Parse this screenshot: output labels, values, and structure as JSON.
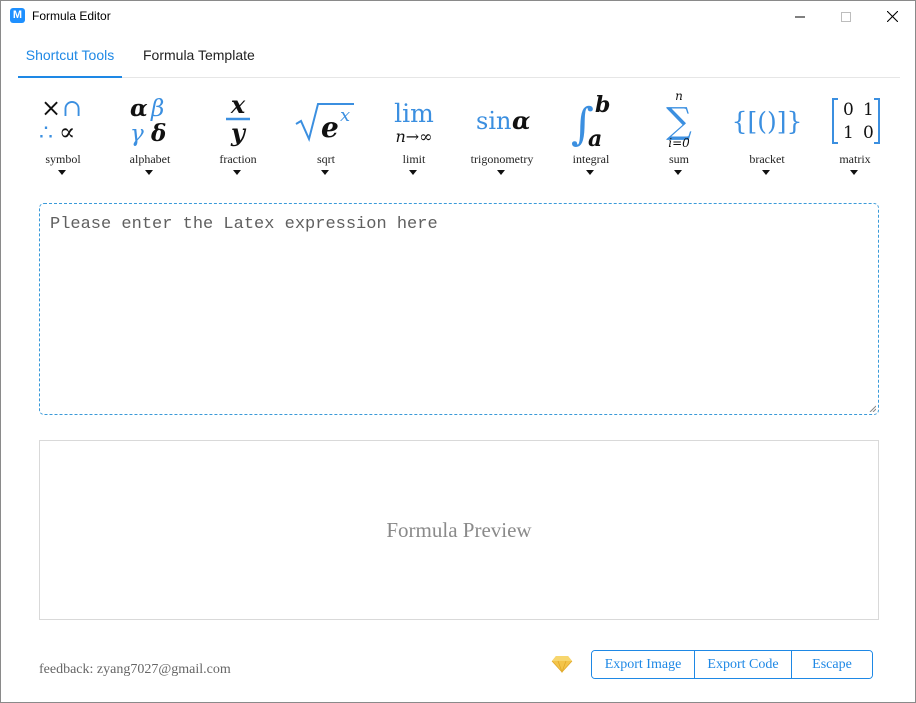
{
  "window": {
    "title": "Formula Editor",
    "icon": "M",
    "controls": [
      "minimize-icon",
      "maximize-icon",
      "close-icon"
    ]
  },
  "tabs": [
    {
      "label": "Shortcut Tools",
      "active": true
    },
    {
      "label": "Formula Template",
      "active": false
    }
  ],
  "tools": [
    {
      "label": "symbol",
      "icon": "symbol-icon"
    },
    {
      "label": "alphabet",
      "icon": "alphabet-icon"
    },
    {
      "label": "fraction",
      "icon": "fraction-icon"
    },
    {
      "label": "sqrt",
      "icon": "sqrt-icon"
    },
    {
      "label": "limit",
      "icon": "limit-icon"
    },
    {
      "label": "trigonometry",
      "icon": "trigonometry-icon"
    },
    {
      "label": "integral",
      "icon": "integral-icon"
    },
    {
      "label": "sum",
      "icon": "sum-icon"
    },
    {
      "label": "bracket",
      "icon": "bracket-icon"
    },
    {
      "label": "matrix",
      "icon": "matrix-icon"
    }
  ],
  "glyphs": {
    "symbol": {
      "times": "×",
      "cap": "∩",
      "therefore": "∴",
      "propto": "∝"
    },
    "alphabet": {
      "alpha": "α",
      "beta": "β",
      "gamma": "γ",
      "delta": "δ"
    },
    "fraction": {
      "num": "x",
      "den": "y"
    },
    "sqrt": {
      "radicand": "e",
      "exp": "x"
    },
    "limit": {
      "op": "lim",
      "sub": "n→∞"
    },
    "trigonometry": {
      "fn": "sin",
      "arg": "α"
    },
    "integral": {
      "sign": "∫",
      "upper": "b",
      "lower": "a"
    },
    "sum": {
      "sign": "∑",
      "upper": "n",
      "lower": "i=0"
    },
    "bracket": {
      "text": "{[()]}"
    },
    "matrix": {
      "cells": [
        "0",
        "1",
        "1",
        "0"
      ]
    }
  },
  "editor": {
    "placeholder": "Please enter the Latex expression here",
    "value": ""
  },
  "preview": {
    "placeholder": "Formula Preview"
  },
  "footer": {
    "feedback": "feedback: zyang7027@gmail.com",
    "buttons": {
      "export_image": "Export Image",
      "export_code": "Export Code",
      "escape": "Escape"
    }
  },
  "colors": {
    "accent": "#1e88e5",
    "glyph_blue": "#3b8fe0",
    "gem": "#f3c44a"
  }
}
